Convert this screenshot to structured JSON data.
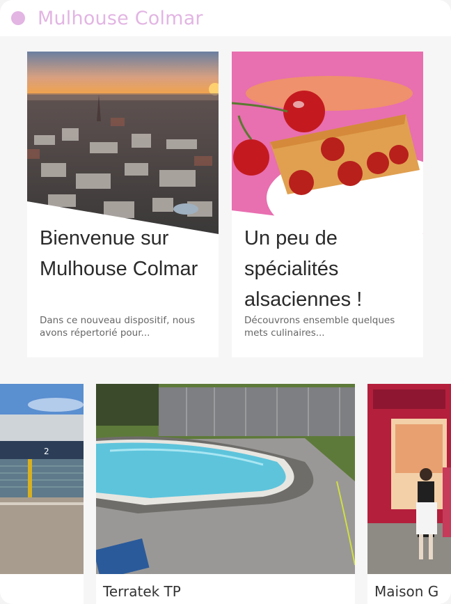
{
  "header": {
    "brand": "Mulhouse Colmar"
  },
  "cards": [
    {
      "title": "Bienvenue sur Mulhouse Colmar",
      "description": "Dans ce nouveau dispositif, nous avons répertorié pour..."
    },
    {
      "title": "Un peu de spécialités alsaciennes !",
      "description": "Découvrons ensemble quelques mets culinaires..."
    }
  ],
  "businesses": [
    {
      "name": ""
    },
    {
      "name": "Terratek TP"
    },
    {
      "name": "Maison G"
    }
  ],
  "colors": {
    "brand": "#e2b5e3",
    "background": "#f6f6f6"
  }
}
